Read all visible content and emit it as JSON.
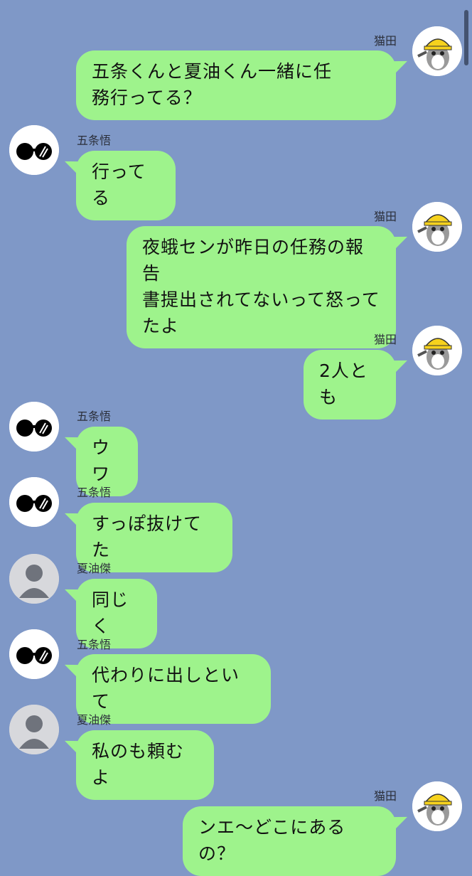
{
  "chat": {
    "messages": [
      {
        "sender": "猫田",
        "side": "right",
        "text": "五条くんと夏油くん一緒に任\n務行ってる？",
        "avatar": "cat-helmet-icon"
      },
      {
        "sender": "五条悟",
        "side": "left",
        "text": "行ってる",
        "avatar": "sunglasses-icon"
      },
      {
        "sender": "猫田",
        "side": "right",
        "text": "夜蛾センが昨日の任務の報告\n書提出されてないって怒って\nたよ",
        "avatar": "cat-helmet-icon"
      },
      {
        "sender": "猫田",
        "side": "right",
        "text": "2人とも",
        "avatar": "cat-helmet-icon"
      },
      {
        "sender": "五条悟",
        "side": "left",
        "text": "ウワ",
        "avatar": "sunglasses-icon"
      },
      {
        "sender": "五条悟",
        "side": "left",
        "text": "すっぽ抜けてた",
        "avatar": "sunglasses-icon"
      },
      {
        "sender": "夏油傑",
        "side": "left",
        "text": "同じく",
        "avatar": "default-person-icon"
      },
      {
        "sender": "五条悟",
        "side": "left",
        "text": "代わりに出しといて",
        "avatar": "sunglasses-icon"
      },
      {
        "sender": "夏油傑",
        "side": "left",
        "text": "私のも頼むよ",
        "avatar": "default-person-icon"
      },
      {
        "sender": "猫田",
        "side": "right",
        "text": "ンエ～どこにあるの？",
        "avatar": "cat-helmet-icon"
      }
    ]
  },
  "colors": {
    "background": "#7f98c7",
    "bubble": "#9ef38c"
  }
}
